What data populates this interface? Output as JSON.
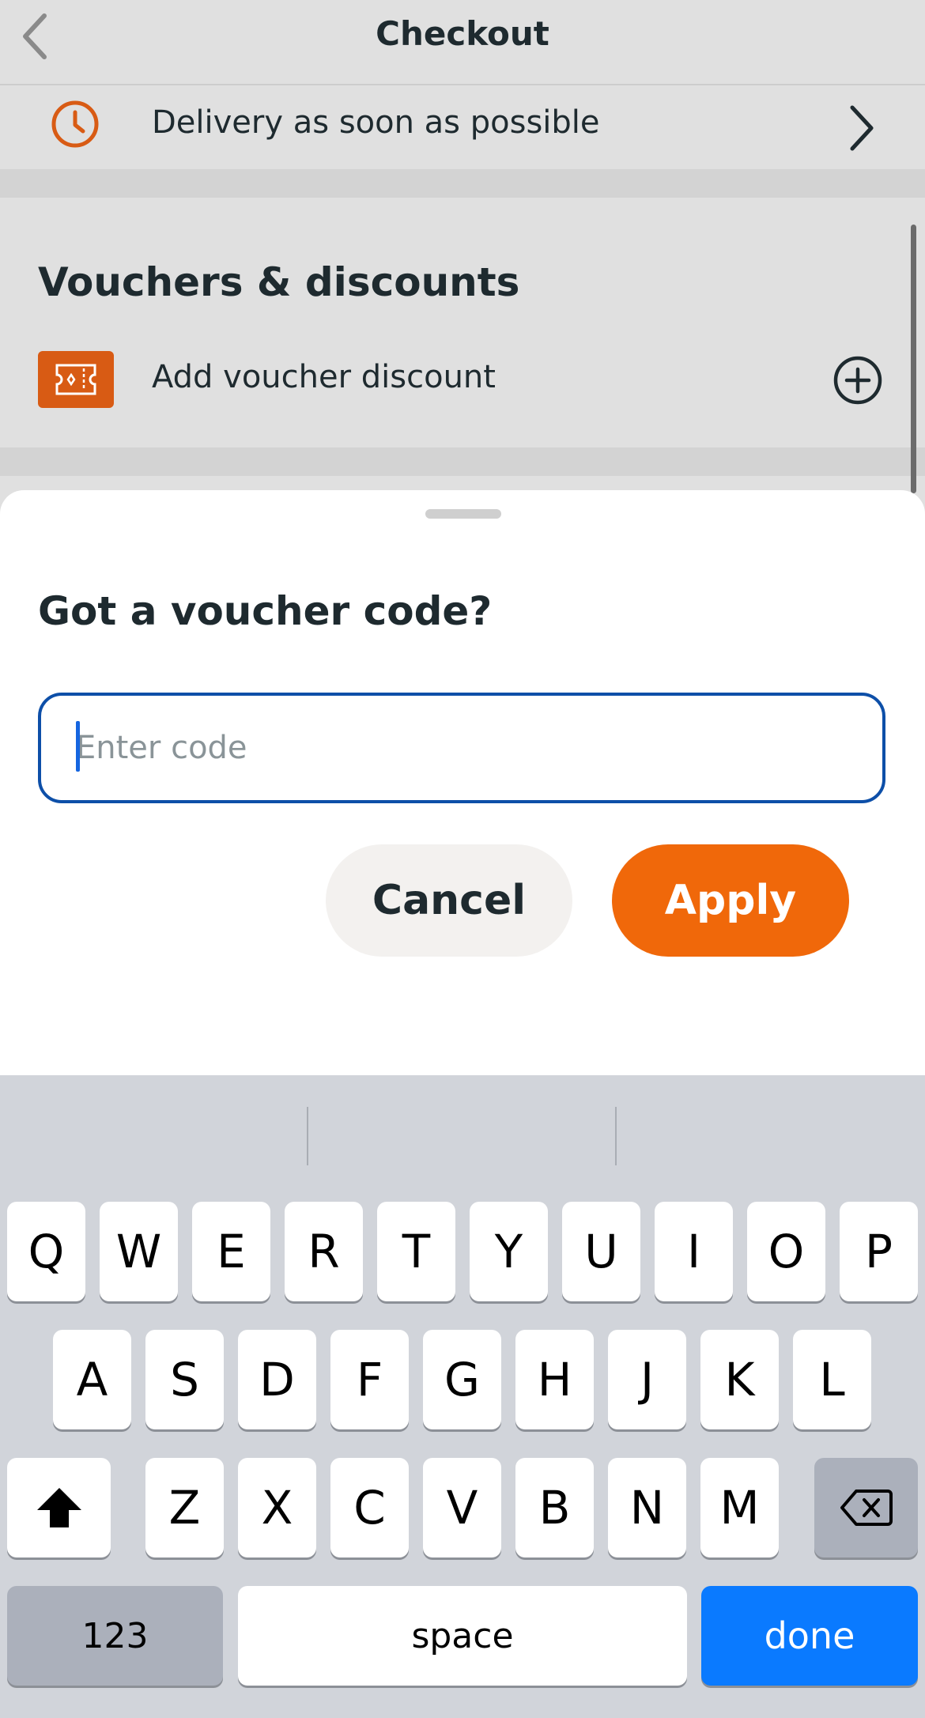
{
  "nav": {
    "title": "Checkout",
    "back_icon": "chevron-left-icon"
  },
  "delivery": {
    "text": "Delivery as soon as possible",
    "icon": "clock-icon"
  },
  "vouchers": {
    "title": "Vouchers & discounts",
    "add_label": "Add voucher discount",
    "badge_icon": "ticket-icon",
    "action_icon": "plus-circle-icon"
  },
  "sheet": {
    "title": "Got a voucher code?",
    "input": {
      "placeholder": "Enter code",
      "value": ""
    },
    "cancel_label": "Cancel",
    "apply_label": "Apply"
  },
  "keyboard": {
    "row1": [
      "Q",
      "W",
      "E",
      "R",
      "T",
      "Y",
      "U",
      "I",
      "O",
      "P"
    ],
    "row2": [
      "A",
      "S",
      "D",
      "F",
      "G",
      "H",
      "J",
      "K",
      "L"
    ],
    "row3": [
      "Z",
      "X",
      "C",
      "V",
      "B",
      "N",
      "M"
    ],
    "numbers_label": "123",
    "space_label": "space",
    "done_label": "done"
  },
  "colors": {
    "accent_orange": "#f0680a",
    "badge_orange": "#d85b14",
    "input_border": "#0d4fa8",
    "keyboard_done": "#0a7aff"
  }
}
